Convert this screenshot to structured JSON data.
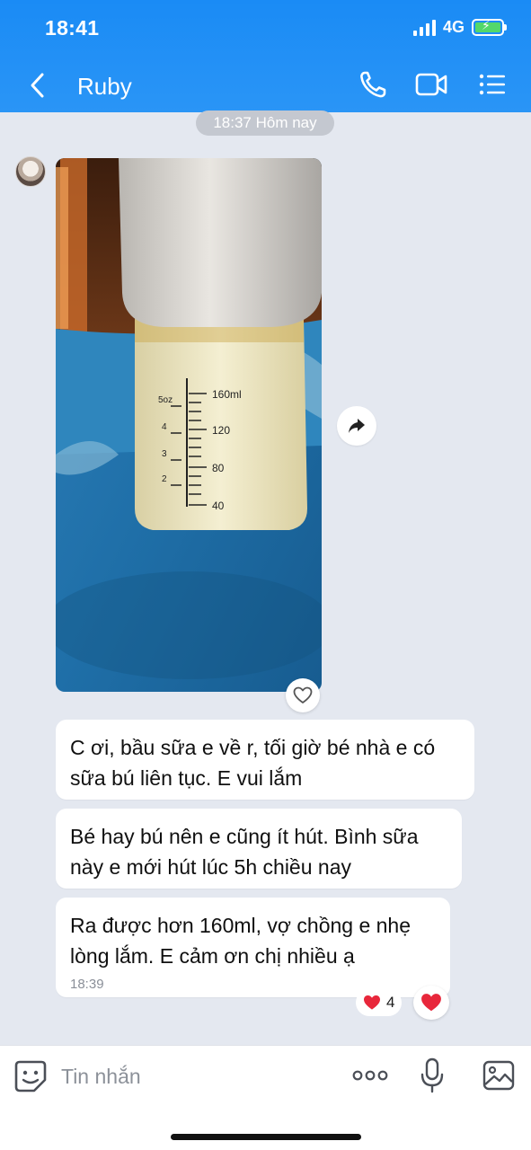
{
  "status_bar": {
    "time": "18:41",
    "network": "4G"
  },
  "header": {
    "contact_name": "Ruby",
    "back_icon": "chevron-left-icon",
    "call_icon": "phone-icon",
    "video_icon": "video-camera-icon",
    "menu_icon": "list-menu-icon"
  },
  "chat": {
    "time_separator": "18:37 Hôm nay",
    "photo_description_icon": "milk-bottle-photo",
    "forward_icon": "share-arrow-icon",
    "photo_reaction_icon": "heart-outline-icon",
    "messages": [
      {
        "text": "C ơi, bầu sữa e về r, tối giờ bé nhà e có sữa bú liên tục. E vui lắm"
      },
      {
        "text": "Bé hay bú nên e cũng ít hút. Bình sữa này e mới hút lúc 5h chiều nay"
      },
      {
        "text": "Ra được hơn 160ml, vợ chồng e nhẹ lòng lắm. E cảm ơn chị nhiều ạ",
        "time": "18:39"
      }
    ],
    "reaction_count": "4",
    "reaction_icon": "heart-icon"
  },
  "photo_bottle": {
    "scale_ml": [
      "160ml",
      "120",
      "80",
      "40"
    ],
    "scale_oz": [
      "5oz",
      "4",
      "3",
      "2"
    ]
  },
  "input_bar": {
    "placeholder": "Tin nhắn",
    "emoji_icon": "emoji-sticker-icon",
    "more_icon": "more-dots-icon",
    "mic_icon": "microphone-icon",
    "image_icon": "image-gallery-icon"
  },
  "colors": {
    "header_blue": "#1a8bf5",
    "chat_background": "#e4e8f0",
    "reaction_red": "#e8273b"
  }
}
